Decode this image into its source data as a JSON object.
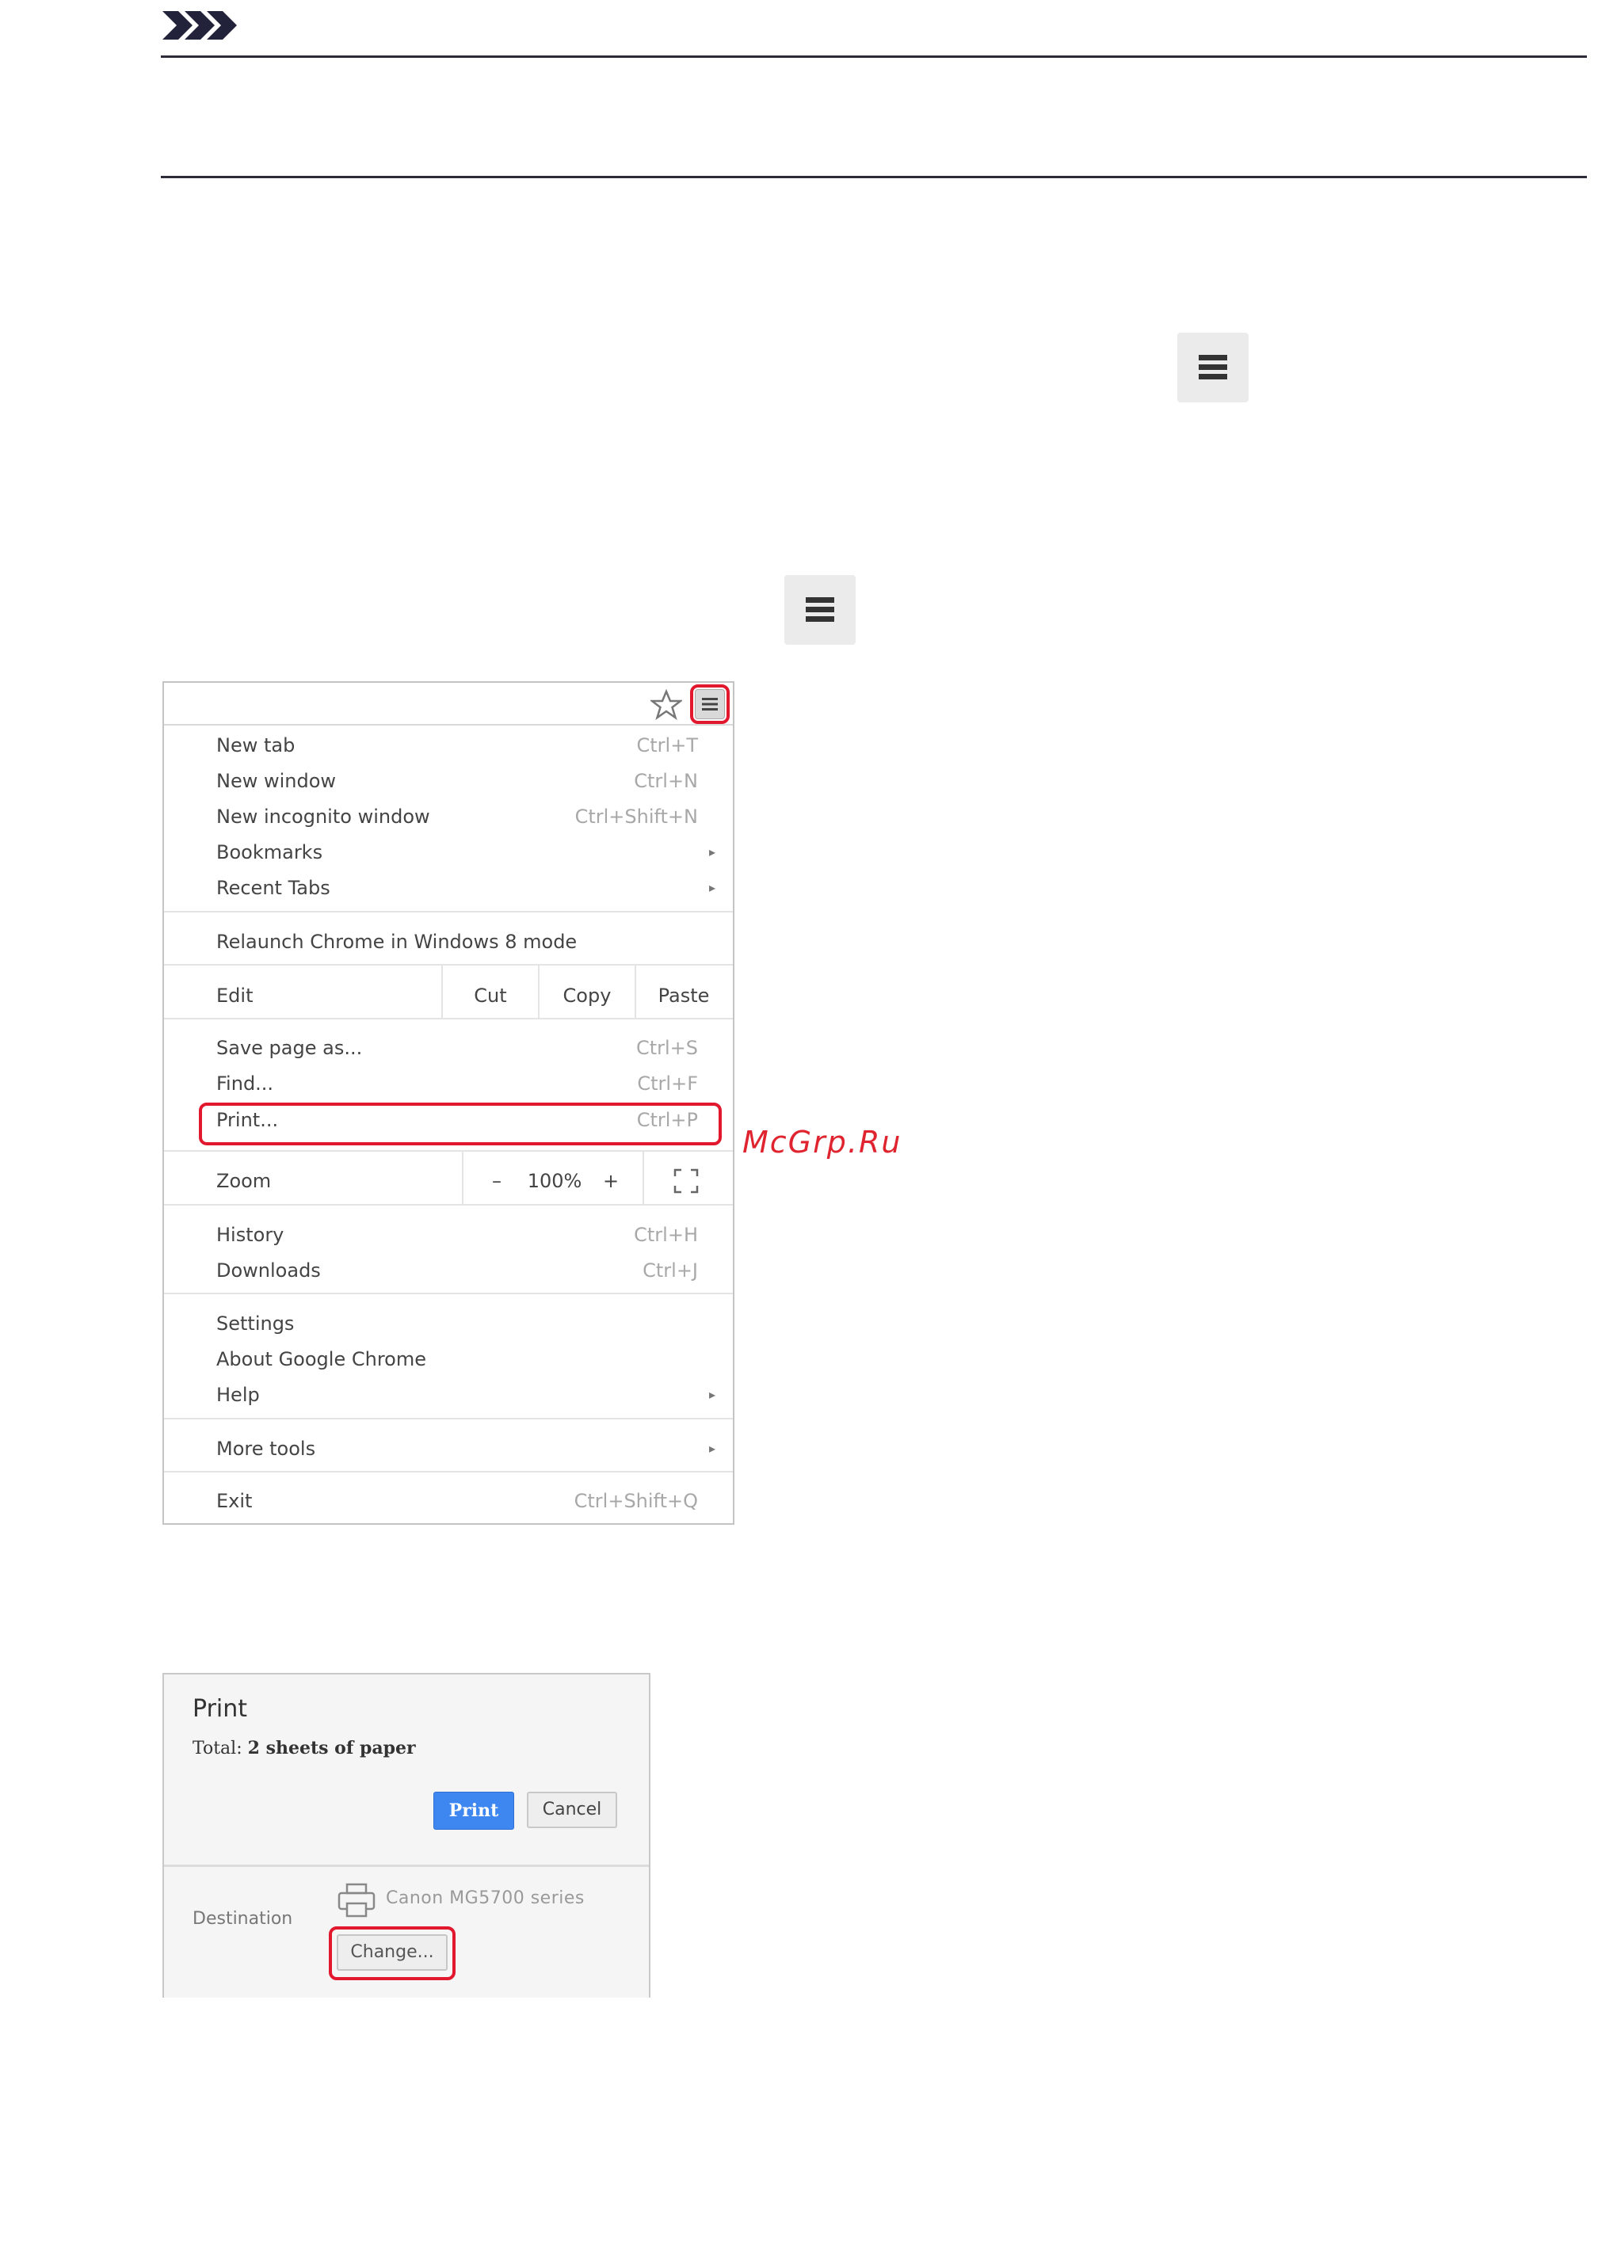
{
  "icons": {
    "note": "note-chevrons-icon",
    "menu": "hamburger-menu-icon",
    "star": "bookmark-star-icon",
    "printer": "printer-icon",
    "fullscreen": "fullscreen-icon"
  },
  "colors": {
    "highlight": "#e2182f",
    "watermark": "#e0242f",
    "print_button": "#3f87f0"
  },
  "chrome_menu": {
    "items": [
      {
        "label": "New tab",
        "shortcut": "Ctrl+T"
      },
      {
        "label": "New window",
        "shortcut": "Ctrl+N"
      },
      {
        "label": "New incognito window",
        "shortcut": "Ctrl+Shift+N"
      },
      {
        "label": "Bookmarks",
        "arrow": "▸"
      },
      {
        "label": "Recent Tabs",
        "arrow": "▸"
      },
      {
        "label": "Relaunch Chrome in Windows 8 mode"
      },
      {
        "label": "Save page as...",
        "shortcut": "Ctrl+S"
      },
      {
        "label": "Find...",
        "shortcut": "Ctrl+F"
      },
      {
        "label": "Print...",
        "shortcut": "Ctrl+P"
      },
      {
        "label": "History",
        "shortcut": "Ctrl+H"
      },
      {
        "label": "Downloads",
        "shortcut": "Ctrl+J"
      },
      {
        "label": "Settings"
      },
      {
        "label": "About Google Chrome"
      },
      {
        "label": "Help",
        "arrow": "▸"
      },
      {
        "label": "More tools",
        "arrow": "▸"
      },
      {
        "label": "Exit",
        "shortcut": "Ctrl+Shift+Q"
      }
    ],
    "edit": {
      "label": "Edit",
      "cut": "Cut",
      "copy": "Copy",
      "paste": "Paste"
    },
    "zoom": {
      "label": "Zoom",
      "minus": "–",
      "value": "100%",
      "plus": "+"
    }
  },
  "watermark": "McGrp.Ru",
  "print_dialog": {
    "title": "Print",
    "total_label": "Total:",
    "total_value": "2 sheets of paper",
    "print_button": "Print",
    "cancel_button": "Cancel",
    "destination_label": "Destination",
    "printer_name": "Canon MG5700 series",
    "change_button": "Change..."
  }
}
